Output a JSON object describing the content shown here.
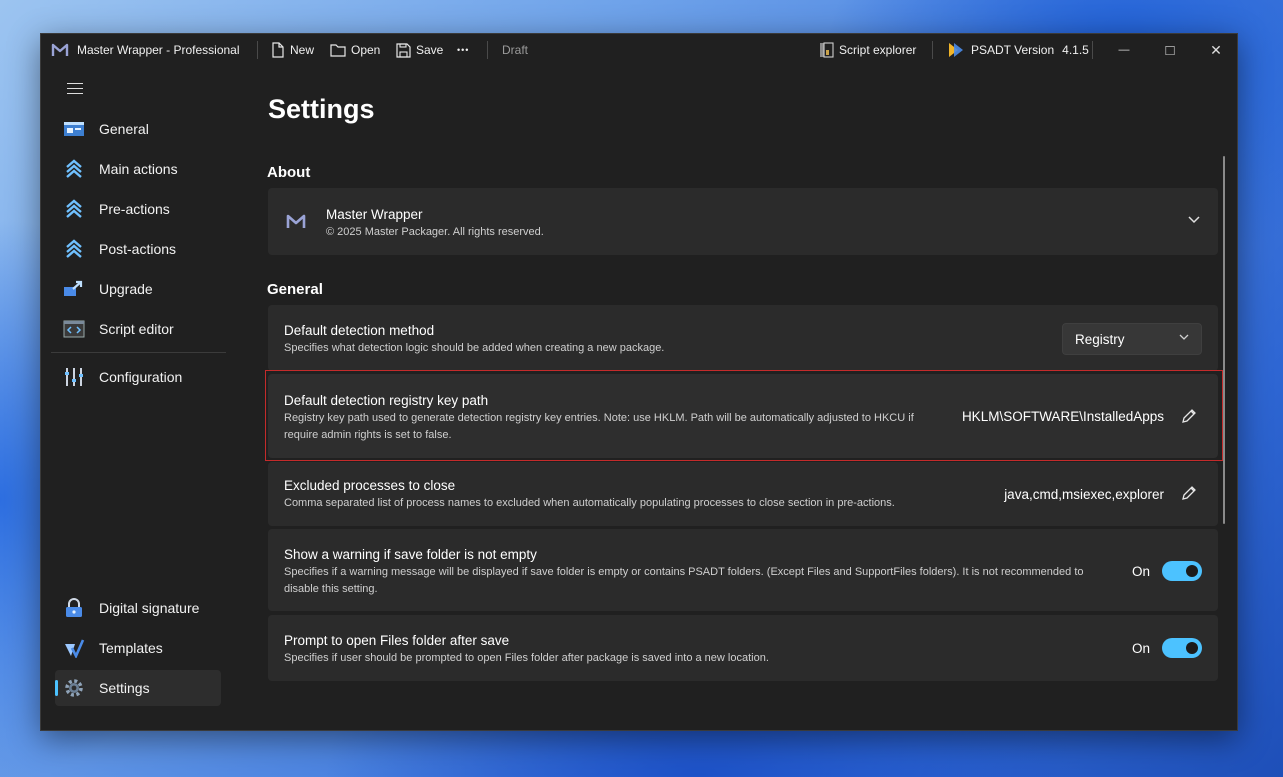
{
  "titlebar": {
    "app_title": "Master Wrapper - Professional",
    "new_label": "New",
    "open_label": "Open",
    "save_label": "Save",
    "more_label": "•••",
    "status": "Draft",
    "script_explorer_label": "Script explorer",
    "psadt_label": "PSADT Version",
    "psadt_version": "4.1.5",
    "minimize": "—",
    "maximize": "□",
    "close": "✕"
  },
  "sidebar": {
    "items": [
      {
        "label": "General",
        "icon": "general-icon"
      },
      {
        "label": "Main actions",
        "icon": "actions-icon"
      },
      {
        "label": "Pre-actions",
        "icon": "actions-icon"
      },
      {
        "label": "Post-actions",
        "icon": "actions-icon"
      },
      {
        "label": "Upgrade",
        "icon": "upgrade-icon"
      },
      {
        "label": "Script editor",
        "icon": "code-icon"
      },
      {
        "label": "Configuration",
        "icon": "sliders-icon"
      },
      {
        "label": "Digital signature",
        "icon": "lock-icon"
      },
      {
        "label": "Templates",
        "icon": "templates-icon"
      },
      {
        "label": "Settings",
        "icon": "gear-icon"
      }
    ],
    "active": "Settings"
  },
  "page": {
    "title": "Settings",
    "about_heading": "About",
    "about": {
      "name": "Master Wrapper",
      "copyright": "© 2025 Master Packager. All rights reserved."
    },
    "general_heading": "General",
    "settings": [
      {
        "title": "Default detection method",
        "description": "Specifies what detection logic should be added when creating a new package.",
        "value": "Registry"
      },
      {
        "title": "Default detection registry key path",
        "description": "Registry key path used to generate detection registry key entries. Note: use HKLM. Path will be automatically adjusted to HKCU if require admin rights is set to false.",
        "value": "HKLM\\SOFTWARE\\InstalledApps"
      },
      {
        "title": "Excluded processes to close",
        "description": "Comma separated list of process names to excluded when automatically populating processes to close section in pre-actions.",
        "value": "java,cmd,msiexec,explorer"
      },
      {
        "title": "Show a warning if save folder is not empty",
        "description": "Specifies if a warning message will be displayed if save folder is empty or contains PSADT folders. (Except Files and SupportFiles folders). It is not recommended to disable this setting.",
        "toggle_label": "On"
      },
      {
        "title": "Prompt to open Files folder after save",
        "description": "Specifies if user should be prompted to open Files folder after package is saved into a new location.",
        "toggle_label": "On"
      }
    ]
  },
  "colors": {
    "accent": "#4cc2ff",
    "highlight": "#c42b2b"
  }
}
